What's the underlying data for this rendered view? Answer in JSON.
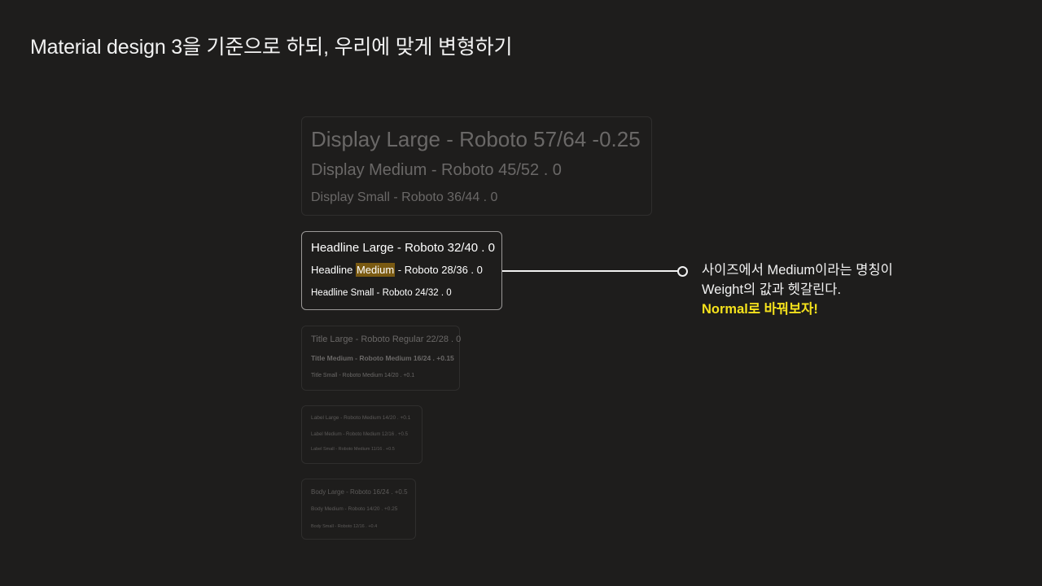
{
  "slide": {
    "title": "Material design 3을 기준으로 하되, 우리에 맞게 변형하기"
  },
  "display_group": {
    "large": "Display Large - Roboto 57/64 -0.25",
    "medium": "Display Medium - Roboto 45/52 .  0",
    "small": "Display Small - Roboto 36/44 . 0"
  },
  "headline_group": {
    "large": "Headline Large - Roboto 32/40 . 0",
    "medium_prefix": "Headline ",
    "medium_highlight": "Medium",
    "medium_suffix": " - Roboto 28/36 . 0",
    "small": "Headline Small - Roboto 24/32 . 0",
    "highlight_color": "#7a5a12"
  },
  "title_group": {
    "large": "Title Large - Roboto Regular 22/28 . 0",
    "medium": "Title Medium - Roboto Medium 16/24 . +0.15",
    "small": "Title Small - Roboto Medium 14/20 . +0.1"
  },
  "label_group": {
    "large": "Label Large - Roboto Medium 14/20 . +0.1",
    "medium": "Label Medium - Roboto Medium 12/16 . +0.5",
    "small": "Label Small - Roboto Medium 11/16 . +0.5"
  },
  "body_group": {
    "large": "Body Large - Roboto 16/24 . +0.5",
    "medium": "Body Medium - Roboto 14/20 . +0.25",
    "small": "Body Small - Roboto 12/16 . +0.4"
  },
  "note": {
    "line1": "사이즈에서 Medium이라는 명칭이",
    "line2": "Weight의 값과 헷갈린다.",
    "emphasis": "Normal로 바꿔보자!",
    "emphasis_color": "#f5e21c"
  }
}
